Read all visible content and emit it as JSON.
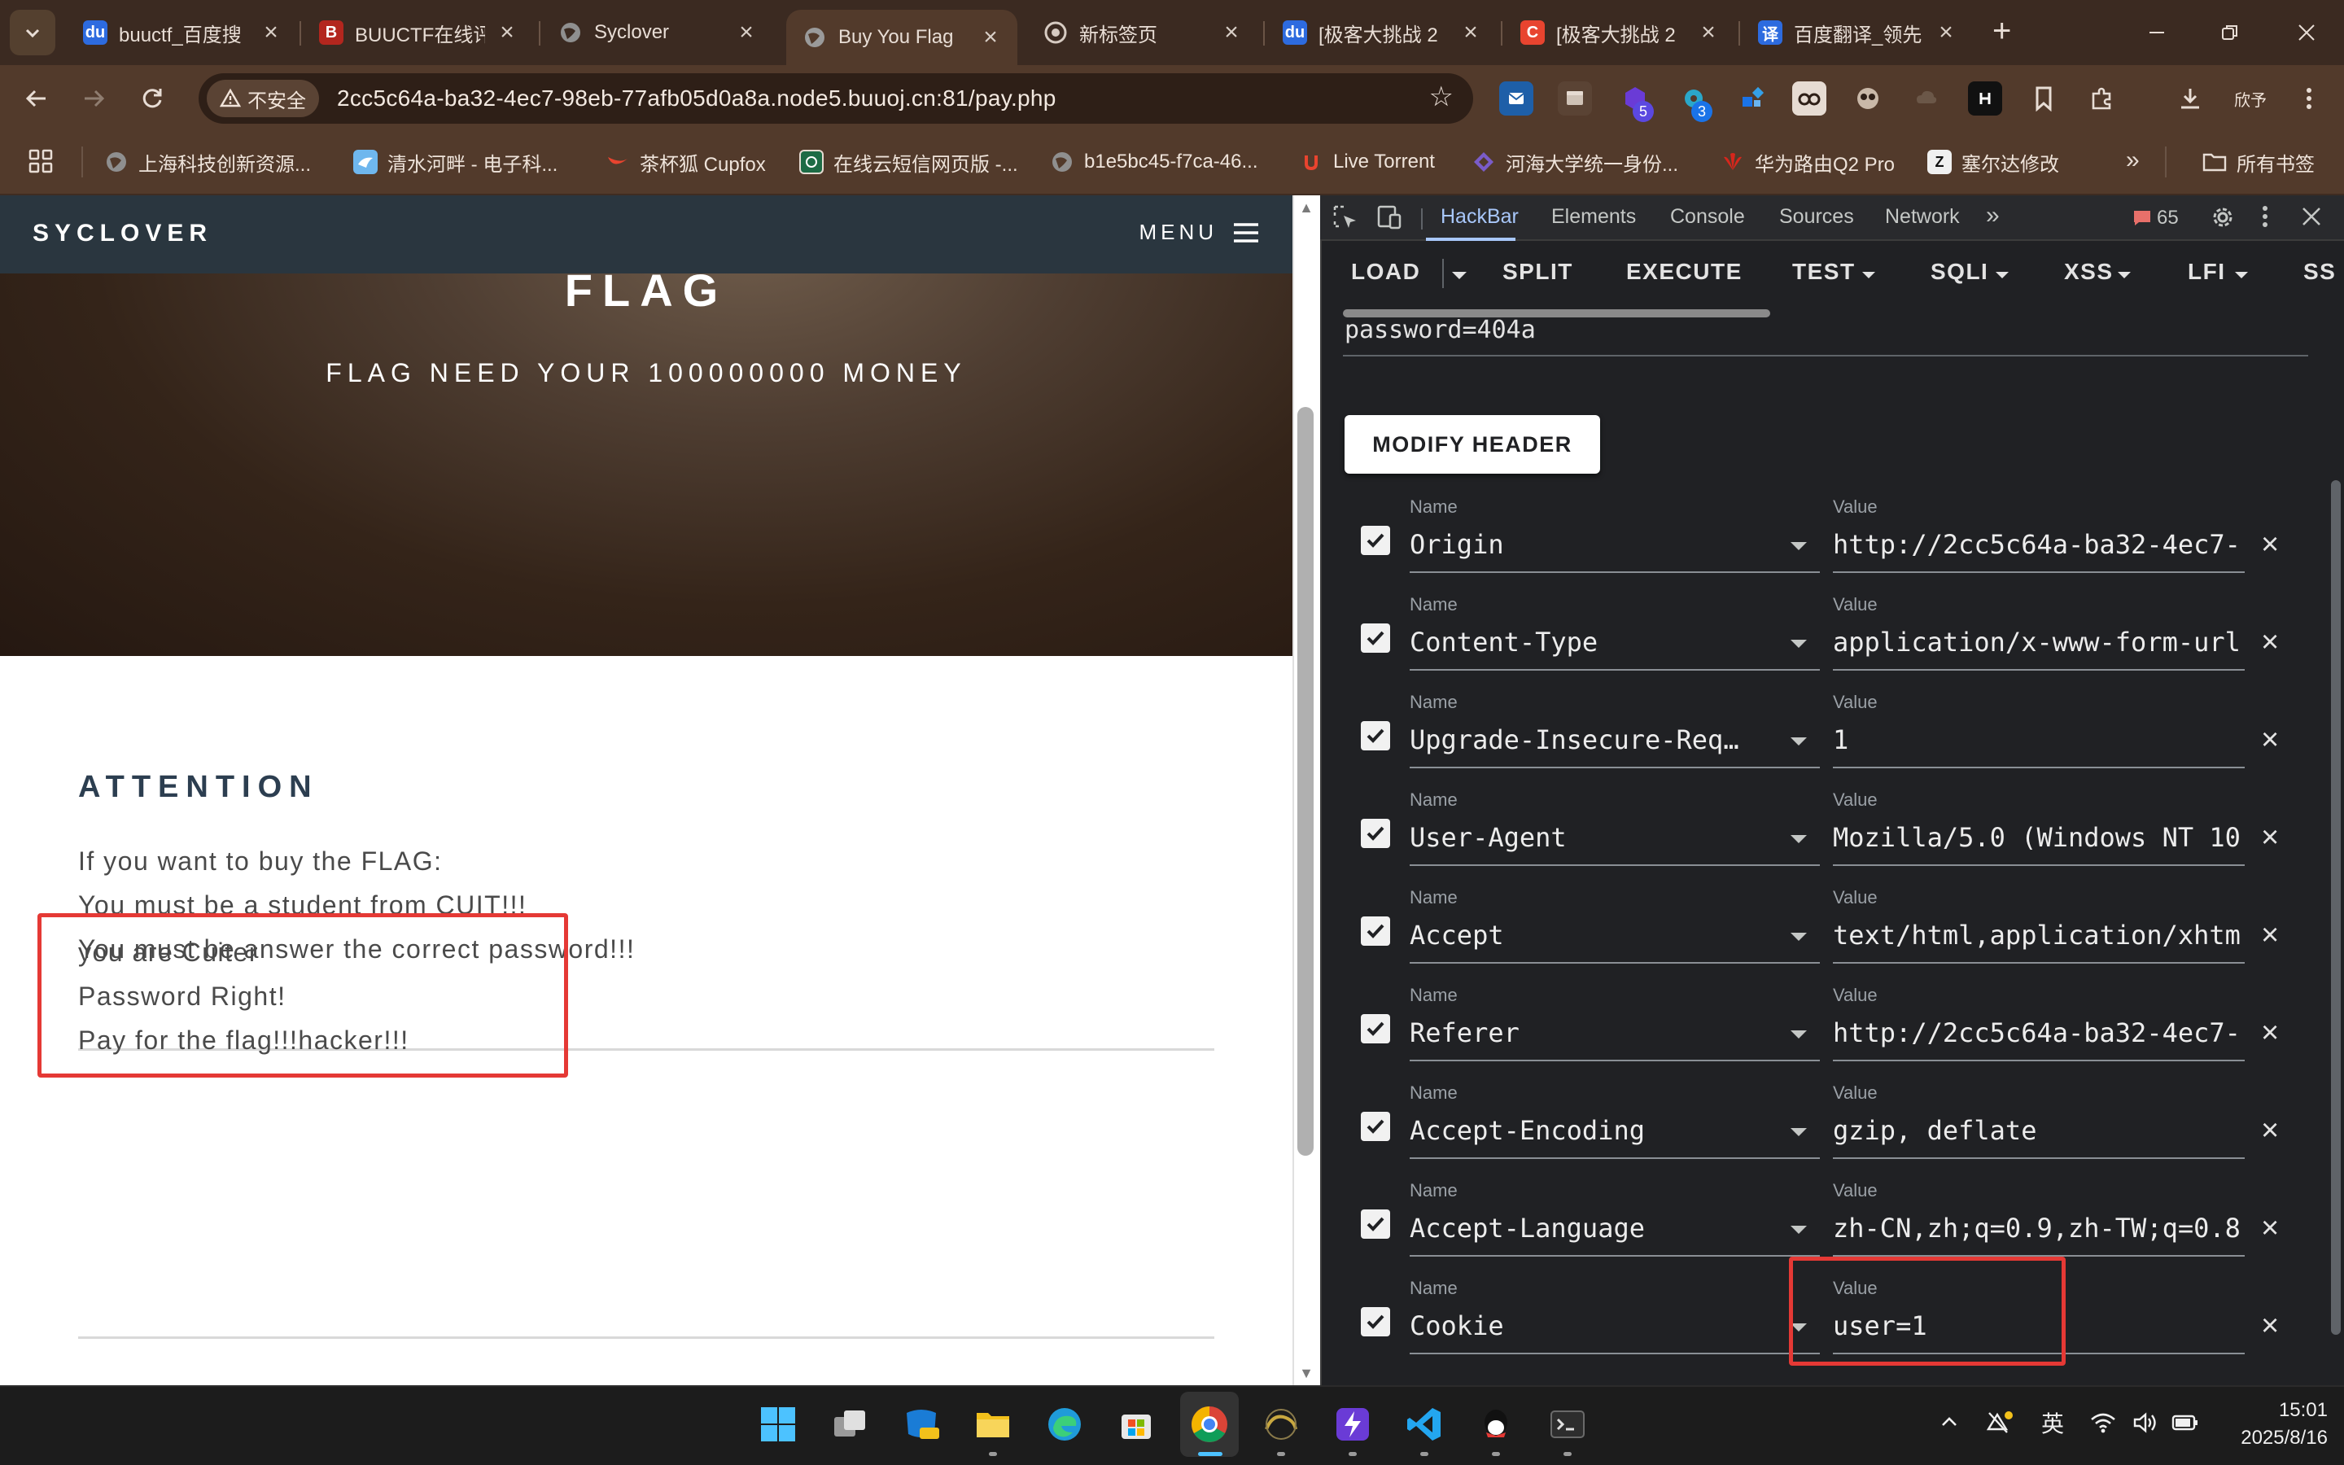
{
  "browser": {
    "tabs": [
      {
        "title": "buuctf_百度搜",
        "fav": "baidu",
        "fav_text": "du",
        "fav_color": "#2d6bdf",
        "active": false
      },
      {
        "title": "BUUCTF在线评",
        "fav": "buuctf",
        "fav_text": "B",
        "fav_color": "#b3261e",
        "active": false
      },
      {
        "title": "Syclover",
        "fav": "globe",
        "fav_text": "",
        "fav_color": "#5f5f5f",
        "active": false
      },
      {
        "title": "Buy You Flag",
        "fav": "globe",
        "fav_text": "",
        "fav_color": "#5f5f5f",
        "active": true
      },
      {
        "title": "新标签页",
        "fav": "chrome",
        "fav_text": "",
        "fav_color": "#5f5f5f",
        "active": false
      },
      {
        "title": "[极客大挑战 2",
        "fav": "baidu",
        "fav_text": "du",
        "fav_color": "#2d6bdf",
        "active": false
      },
      {
        "title": "[极客大挑战 2",
        "fav": "csdn",
        "fav_text": "C",
        "fav_color": "#e8442f",
        "active": false
      },
      {
        "title": "百度翻译_领先",
        "fav": "translate",
        "fav_text": "译",
        "fav_color": "#2d6bdf",
        "active": false
      }
    ],
    "insecure_label": "不安全",
    "url": "2cc5c64a-ba32-4ec7-98eb-77afb05d0a8a.node5.buuoj.cn:81/pay.php",
    "ext_badge_1": "5",
    "ext_badge_2": "3",
    "profile_label": "欣予",
    "bookmarks": [
      {
        "label": "上海科技创新资源...",
        "icon": "globe"
      },
      {
        "label": "清水河畔 - 电子科...",
        "icon": "bird"
      },
      {
        "label": "茶杯狐 Cupfox",
        "icon": "cupfox"
      },
      {
        "label": "在线云短信网页版 -...",
        "icon": "sms"
      },
      {
        "label": "b1e5bc45-f7ca-46...",
        "icon": "globe"
      },
      {
        "label": "Live Torrent",
        "icon": "torrent"
      },
      {
        "label": "河海大学统一身份...",
        "icon": "hhu"
      },
      {
        "label": "华为路由Q2 Pro",
        "icon": "huawei"
      },
      {
        "label": "塞尔达修改",
        "icon": "zelda"
      }
    ],
    "all_bookmarks": "所有书签"
  },
  "site": {
    "brand": "SYCLOVER",
    "menu": "MENU",
    "hero_title": "FLAG",
    "hero_subtitle": "FLAG NEED YOUR 100000000 MONEY",
    "attention_title": "ATTENTION",
    "attention_lines": [
      "If you want to buy the FLAG:",
      "You must be a student from CUIT!!!",
      "You must be answer the correct password!!!"
    ],
    "result_lines": [
      "you are Cuiter",
      "Password Right!",
      "Pay for the flag!!!hacker!!!"
    ]
  },
  "devtools": {
    "tabs": [
      "HackBar",
      "Elements",
      "Console",
      "Sources",
      "Network"
    ],
    "active_tab": "HackBar",
    "issues_count": "65",
    "hackbar_buttons": [
      "LOAD",
      "SPLIT",
      "EXECUTE",
      "TEST",
      "SQLI",
      "XSS",
      "LFI",
      "SS"
    ],
    "post_body": "password=404a",
    "modify_header_label": "MODIFY HEADER",
    "name_label": "Name",
    "value_label": "Value",
    "headers": [
      {
        "name": "Origin",
        "value": "http://2cc5c64a-ba32-4ec7-",
        "checked": true
      },
      {
        "name": "Content-Type",
        "value": "application/x-www-form-url",
        "checked": true
      },
      {
        "name": "Upgrade-Insecure-Req…",
        "value": "1",
        "checked": true
      },
      {
        "name": "User-Agent",
        "value": "Mozilla/5.0 (Windows NT 10",
        "checked": true
      },
      {
        "name": "Accept",
        "value": "text/html,application/xhtm",
        "checked": true
      },
      {
        "name": "Referer",
        "value": "http://2cc5c64a-ba32-4ec7-",
        "checked": true
      },
      {
        "name": "Accept-Encoding",
        "value": "gzip, deflate",
        "checked": true
      },
      {
        "name": "Accept-Language",
        "value": "zh-CN,zh;q=0.9,zh-TW;q=0.8",
        "checked": true
      },
      {
        "name": "Cookie",
        "value": "user=1",
        "checked": true
      }
    ]
  },
  "taskbar": {
    "ime": "英",
    "time": "15:01",
    "date": "2025/8/16"
  },
  "colors": {
    "highlight": "#e53935",
    "hackbar_accent": "#a8c7fa"
  }
}
